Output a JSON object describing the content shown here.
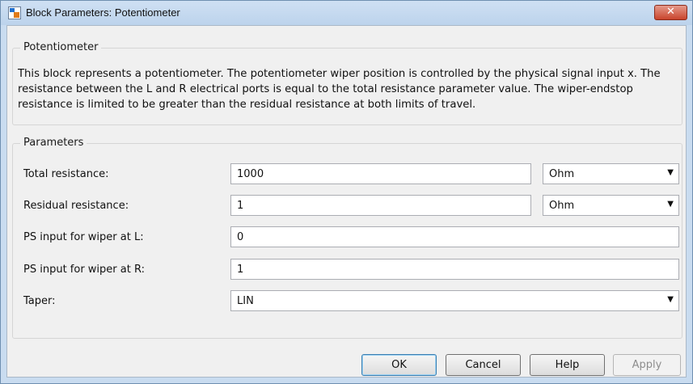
{
  "window": {
    "title": "Block Parameters: Potentiometer",
    "close_label": "✕"
  },
  "description_group": {
    "label": "Potentiometer",
    "text": "This block represents a potentiometer. The potentiometer wiper position is controlled by the physical signal input x. The resistance between the L and R electrical ports is equal to the total resistance parameter value. The wiper-endstop resistance is limited to be greater than the residual resistance at both limits of travel."
  },
  "parameters": {
    "label": "Parameters",
    "rows": [
      {
        "label": "Total resistance:",
        "value": "1000",
        "unit": "Ohm"
      },
      {
        "label": "Residual resistance:",
        "value": "1",
        "unit": "Ohm"
      },
      {
        "label": "PS input for wiper at L:",
        "value": "0"
      },
      {
        "label": "PS input for wiper at R:",
        "value": "1"
      },
      {
        "label": "Taper:",
        "value": "LIN"
      }
    ]
  },
  "buttons": {
    "ok": "OK",
    "cancel": "Cancel",
    "help": "Help",
    "apply": "Apply"
  }
}
